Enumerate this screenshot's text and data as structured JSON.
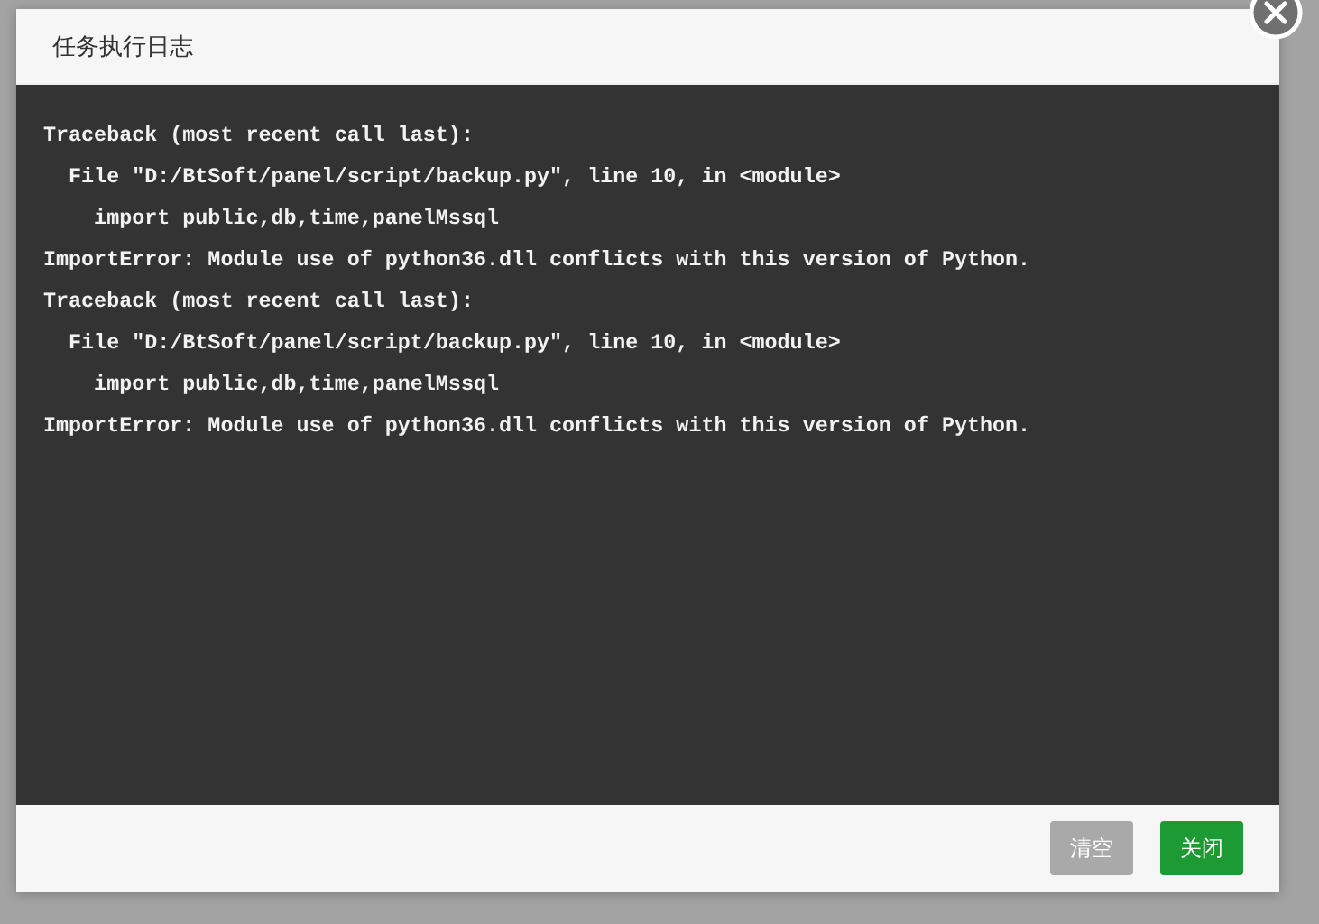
{
  "dialog": {
    "title": "任务执行日志",
    "log_lines": [
      "Traceback (most recent call last):",
      "  File \"D:/BtSoft/panel/script/backup.py\", line 10, in <module>",
      "    import public,db,time,panelMssql",
      "ImportError: Module use of python36.dll conflicts with this version of Python.",
      "Traceback (most recent call last):",
      "  File \"D:/BtSoft/panel/script/backup.py\", line 10, in <module>",
      "    import public,db,time,panelMssql",
      "ImportError: Module use of python36.dll conflicts with this version of Python."
    ],
    "buttons": [
      {
        "label": "清空",
        "kind": "secondary",
        "disabled": true
      },
      {
        "label": "关闭",
        "kind": "primary",
        "disabled": false
      }
    ]
  }
}
